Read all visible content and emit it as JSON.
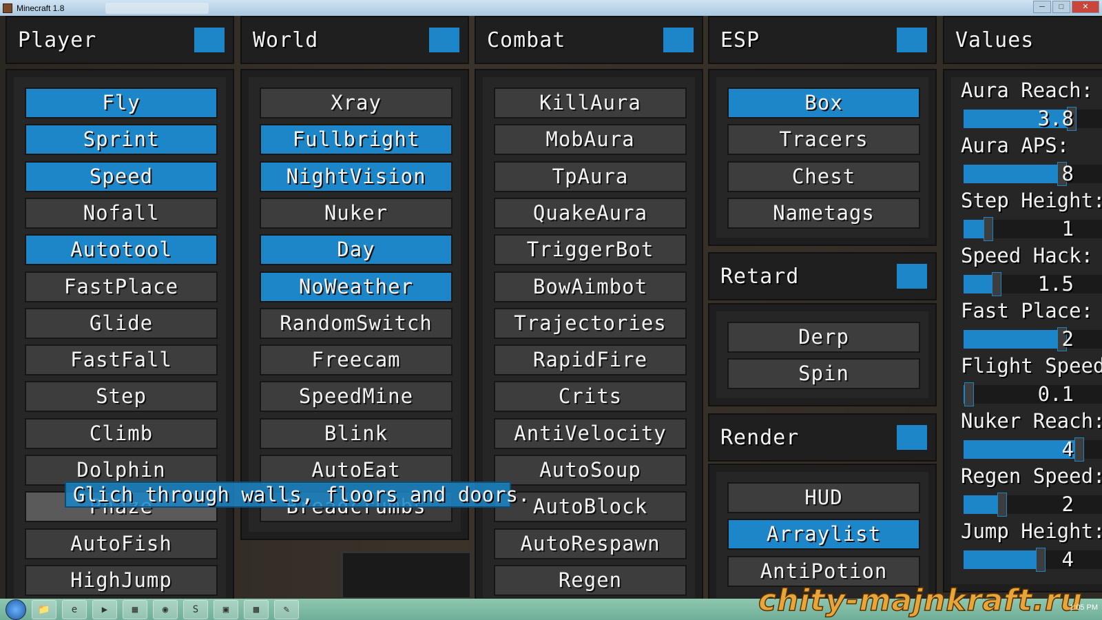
{
  "window": {
    "title": "Minecraft 1.8",
    "minimize": "─",
    "maximize": "□",
    "close": "✕"
  },
  "colors": {
    "accent": "#1c86c8",
    "button": "#3d3d3d",
    "panel": "#1e1e1e"
  },
  "categories": [
    {
      "id": "player",
      "title": "Player",
      "enabled": true,
      "items": [
        {
          "label": "Fly",
          "on": true
        },
        {
          "label": "Sprint",
          "on": true
        },
        {
          "label": "Speed",
          "on": true
        },
        {
          "label": "Nofall",
          "on": false
        },
        {
          "label": "Autotool",
          "on": true
        },
        {
          "label": "FastPlace",
          "on": false
        },
        {
          "label": "Glide",
          "on": false
        },
        {
          "label": "FastFall",
          "on": false
        },
        {
          "label": "Step",
          "on": false
        },
        {
          "label": "Climb",
          "on": false
        },
        {
          "label": "Dolphin",
          "on": false
        },
        {
          "label": "Phaze",
          "on": false,
          "hover": true
        },
        {
          "label": "AutoFish",
          "on": false
        },
        {
          "label": "HighJump",
          "on": false
        }
      ]
    },
    {
      "id": "world",
      "title": "World",
      "enabled": true,
      "items": [
        {
          "label": "Xray",
          "on": false
        },
        {
          "label": "Fullbright",
          "on": true
        },
        {
          "label": "NightVision",
          "on": true
        },
        {
          "label": "Nuker",
          "on": false
        },
        {
          "label": "Day",
          "on": true
        },
        {
          "label": "NoWeather",
          "on": true
        },
        {
          "label": "RandomSwitch",
          "on": false
        },
        {
          "label": "Freecam",
          "on": false
        },
        {
          "label": "SpeedMine",
          "on": false
        },
        {
          "label": "Blink",
          "on": false
        },
        {
          "label": "AutoEat",
          "on": false
        },
        {
          "label": "Breadcrumbs",
          "on": false
        }
      ]
    },
    {
      "id": "combat",
      "title": "Combat",
      "enabled": true,
      "items": [
        {
          "label": "KillAura",
          "on": false
        },
        {
          "label": "MobAura",
          "on": false
        },
        {
          "label": "TpAura",
          "on": false
        },
        {
          "label": "QuakeAura",
          "on": false
        },
        {
          "label": "TriggerBot",
          "on": false
        },
        {
          "label": "BowAimbot",
          "on": false
        },
        {
          "label": "Trajectories",
          "on": false
        },
        {
          "label": "RapidFire",
          "on": false
        },
        {
          "label": "Crits",
          "on": false
        },
        {
          "label": "AntiVelocity",
          "on": false
        },
        {
          "label": "AutoSoup",
          "on": false
        },
        {
          "label": "AutoBlock",
          "on": false
        },
        {
          "label": "AutoRespawn",
          "on": false
        },
        {
          "label": "Regen",
          "on": false
        }
      ]
    },
    {
      "id": "esp",
      "title": "ESP",
      "enabled": true,
      "items": [
        {
          "label": "Box",
          "on": true
        },
        {
          "label": "Tracers",
          "on": false
        },
        {
          "label": "Chest",
          "on": false
        },
        {
          "label": "Nametags",
          "on": false
        }
      ]
    },
    {
      "id": "retard",
      "title": "Retard",
      "enabled": true,
      "items": [
        {
          "label": "Derp",
          "on": false
        },
        {
          "label": "Spin",
          "on": false
        }
      ]
    },
    {
      "id": "render",
      "title": "Render",
      "enabled": true,
      "items": [
        {
          "label": "HUD",
          "on": false
        },
        {
          "label": "Arraylist",
          "on": true
        },
        {
          "label": "AntiPotion",
          "on": false
        }
      ]
    }
  ],
  "values": {
    "title": "Values",
    "sliders": [
      {
        "label": "Aura Reach:",
        "value": "3.8",
        "fill_pct": 56
      },
      {
        "label": "Aura APS:",
        "value": "8",
        "fill_pct": 51
      },
      {
        "label": "Step Height:",
        "value": "1",
        "fill_pct": 13
      },
      {
        "label": "Speed Hack:",
        "value": "1.5",
        "fill_pct": 17
      },
      {
        "label": "Fast Place:",
        "value": "2",
        "fill_pct": 51
      },
      {
        "label": "Flight Speed:",
        "value": "0.1",
        "fill_pct": 3
      },
      {
        "label": "Nuker Reach:",
        "value": "4",
        "fill_pct": 60
      },
      {
        "label": "Regen Speed:",
        "value": "2",
        "fill_pct": 20
      },
      {
        "label": "Jump Height:",
        "value": "4",
        "fill_pct": 40
      }
    ]
  },
  "tooltip": "Glich through walls, floors and doors.",
  "taskbar": {
    "apps": [
      "📁",
      "e",
      "▶",
      "▦",
      "◉",
      "S",
      "▣",
      "▩",
      "✎"
    ],
    "clock": "1:05 PM"
  },
  "watermark": "chity-majnkraft.ru"
}
